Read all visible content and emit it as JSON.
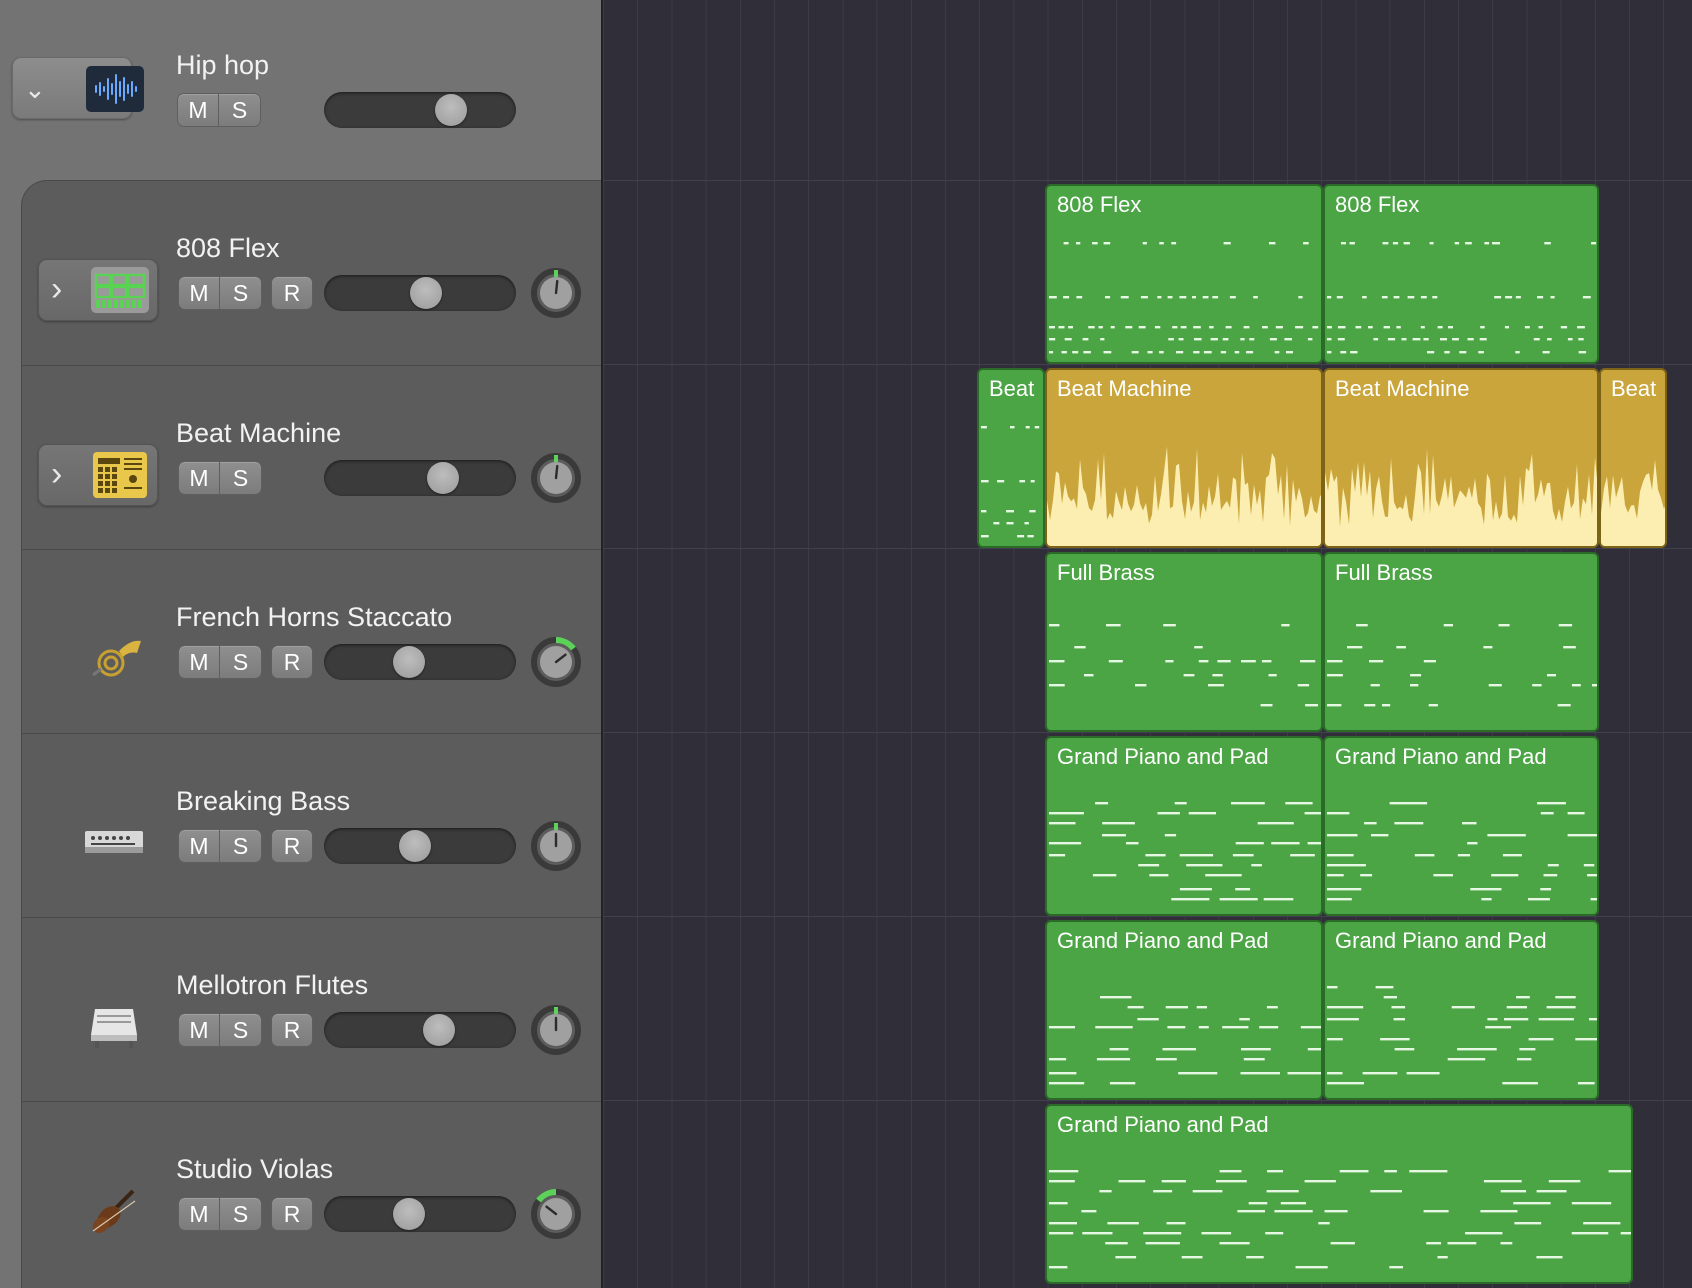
{
  "summary_track": {
    "name": "Hip hop",
    "mute_label": "M",
    "solo_label": "S",
    "volume": 0.7
  },
  "tracks": [
    {
      "name": "808 Flex",
      "icon": "drum-machine-grid-icon",
      "disclosure": true,
      "mute_label": "M",
      "solo_label": "S",
      "record_label": "R",
      "volume": 0.54,
      "pan": 0.04
    },
    {
      "name": "Beat Machine",
      "icon": "beat-machine-icon",
      "disclosure": true,
      "mute_label": "M",
      "solo_label": "S",
      "record_label": null,
      "volume": 0.65,
      "pan": 0.04
    },
    {
      "name": "French Horns Staccato",
      "icon": "french-horn-icon",
      "disclosure": false,
      "mute_label": "M",
      "solo_label": "S",
      "record_label": "R",
      "volume": 0.43,
      "pan": 0.35
    },
    {
      "name": "Breaking Bass",
      "icon": "bass-synth-icon",
      "disclosure": false,
      "mute_label": "M",
      "solo_label": "S",
      "record_label": "R",
      "volume": 0.47,
      "pan": 0.0
    },
    {
      "name": "Mellotron Flutes",
      "icon": "mellotron-icon",
      "disclosure": false,
      "mute_label": "M",
      "solo_label": "S",
      "record_label": "R",
      "volume": 0.62,
      "pan": 0.0
    },
    {
      "name": "Studio Violas",
      "icon": "viola-icon",
      "disclosure": false,
      "mute_label": "M",
      "solo_label": "S",
      "record_label": "R",
      "volume": 0.43,
      "pan": -0.35
    }
  ],
  "regions": [
    {
      "track": 0,
      "title": "808 Flex",
      "color": "#4ba545",
      "kind": "drum"
    },
    {
      "track": 0,
      "title": "808 Flex",
      "color": "#4ba545",
      "kind": "drum"
    },
    {
      "track": 1,
      "title": "Beat",
      "color": "#4ba545",
      "kind": "drum"
    },
    {
      "track": 1,
      "title": "Beat Machine",
      "color": "#c9a53c",
      "kind": "audio"
    },
    {
      "track": 1,
      "title": "Beat Machine",
      "color": "#c9a53c",
      "kind": "audio"
    },
    {
      "track": 1,
      "title": "Beat",
      "color": "#c9a53c",
      "kind": "audio"
    },
    {
      "track": 2,
      "title": "Full Brass",
      "color": "#4ba545",
      "kind": "brass"
    },
    {
      "track": 2,
      "title": "Full Brass",
      "color": "#4ba545",
      "kind": "brass"
    },
    {
      "track": 3,
      "title": "Grand Piano and Pad",
      "color": "#4ba545",
      "kind": "piano"
    },
    {
      "track": 3,
      "title": "Grand Piano and Pad",
      "color": "#4ba545",
      "kind": "piano"
    },
    {
      "track": 4,
      "title": "Grand Piano and Pad",
      "color": "#4ba545",
      "kind": "piano"
    },
    {
      "track": 4,
      "title": "Grand Piano and Pad",
      "color": "#4ba545",
      "kind": "piano"
    },
    {
      "track": 5,
      "title": "Grand Piano and Pad",
      "color": "#4ba545",
      "kind": "piano"
    }
  ]
}
